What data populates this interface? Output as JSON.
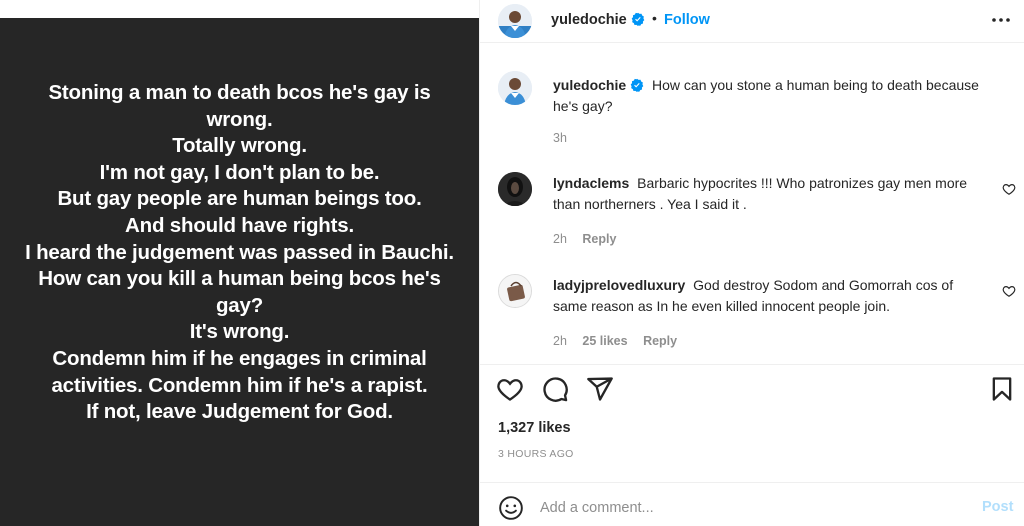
{
  "post_image": {
    "lines": [
      "Stoning a man to death bcos he's gay is",
      "wrong.",
      "Totally wrong.",
      "I'm not gay, I don't plan to be.",
      "But gay people are human beings too.",
      "And should have rights.",
      "I heard the judgement was passed in Bauchi.",
      "How can you kill a human being bcos he's",
      "gay?",
      "It's wrong.",
      "Condemn him if he engages in criminal",
      "activities. Condemn him if he's a rapist.",
      "If not, leave Judgement for God."
    ]
  },
  "header": {
    "username": "yuledochie",
    "separator": "•",
    "follow_label": "Follow",
    "more_icon": "more-horizontal-icon"
  },
  "caption": {
    "username": "yuledochie",
    "text": "How can you stone a human being to death because he's gay?",
    "time": "3h"
  },
  "comments": [
    {
      "username": "lyndaclems",
      "text": "Barbaric hypocrites !!! Who patronizes gay men more than northerners . Yea I said it .",
      "time": "2h",
      "likes": "",
      "reply": "Reply"
    },
    {
      "username": "ladyjprelovedluxury",
      "text": "God destroy Sodom and Gomorrah cos of same reason as In he even killed innocent people join.",
      "time": "2h",
      "likes": "25 likes",
      "reply": "Reply"
    }
  ],
  "actions": {
    "icons": [
      "heart-icon",
      "comment-icon",
      "share-icon",
      "bookmark-icon"
    ]
  },
  "likes": "1,327 likes",
  "time_ago": "3 HOURS AGO",
  "comment_box": {
    "placeholder": "Add a comment...",
    "post_label": "Post"
  },
  "colors": {
    "image_bg": "#262626",
    "link_blue": "#0095f6",
    "post_disabled": "#b2dffc",
    "muted": "#8e8e8e"
  }
}
